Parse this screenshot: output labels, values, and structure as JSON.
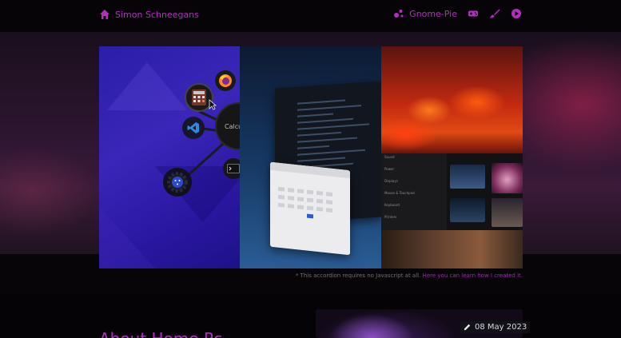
{
  "nav": {
    "home_label": "Simon Schneegans",
    "project_label": "Gnome-Pie"
  },
  "hero": {
    "calculator_label": "Calcu",
    "footnote_text": "* This accordion requires no Javascript at all.",
    "footnote_link": "Here you can learn how I created it."
  },
  "settings_panel": {
    "items": [
      "Sound",
      "Power",
      "Displays",
      "Mouse & Touchpad",
      "Keyboard",
      "Printers"
    ]
  },
  "article": {
    "date": "08 May 2023",
    "title": "About Home Pc"
  },
  "colors": {
    "accent": "#b52cc4",
    "background": "#050305"
  },
  "icons": {
    "home": "home-icon",
    "project": "bubbles-icon",
    "gamepad": "gamepad-icon",
    "brush": "brush-icon",
    "play": "play-circle-icon",
    "pencil": "pencil-icon"
  }
}
